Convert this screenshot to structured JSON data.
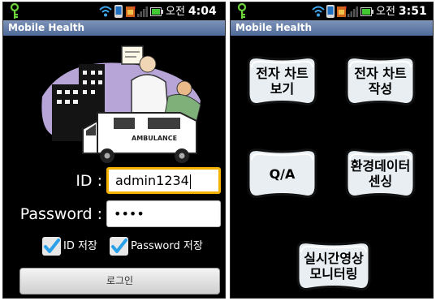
{
  "left_screen": {
    "statusbar": {
      "ampm": "오전",
      "time": "4:04"
    },
    "app_title": "Mobile Health",
    "login": {
      "id_label": "ID :",
      "id_value": "admin1234",
      "password_label": "Password :",
      "password_value": "••••",
      "save_id_label": "ID 저장",
      "save_password_label": "Password 저장",
      "save_id_checked": true,
      "save_password_checked": true,
      "login_button_label": "로그인"
    },
    "illustration_text": "AMBULANCE"
  },
  "right_screen": {
    "statusbar": {
      "ampm": "오전",
      "time": "3:51"
    },
    "app_title": "Mobile Health",
    "menu": {
      "view_chart": [
        "전자 차트",
        "보기"
      ],
      "write_chart": [
        "전자 차트",
        "작성"
      ],
      "qa": [
        "Q/A"
      ],
      "env_sensing": [
        "환경데이터",
        "센싱"
      ],
      "realtime_video": [
        "실시간영상",
        "모니터링"
      ]
    }
  },
  "colors": {
    "titlebar": "#5a74a4",
    "focus_border": "#f5b300",
    "checkbox_check": "#2aa0e8",
    "button_face": "#e8eef2"
  },
  "icons": [
    "key-icon",
    "wifi-icon",
    "phone-icon",
    "sim-icon",
    "signal-icon",
    "battery-icon",
    "check-icon"
  ]
}
